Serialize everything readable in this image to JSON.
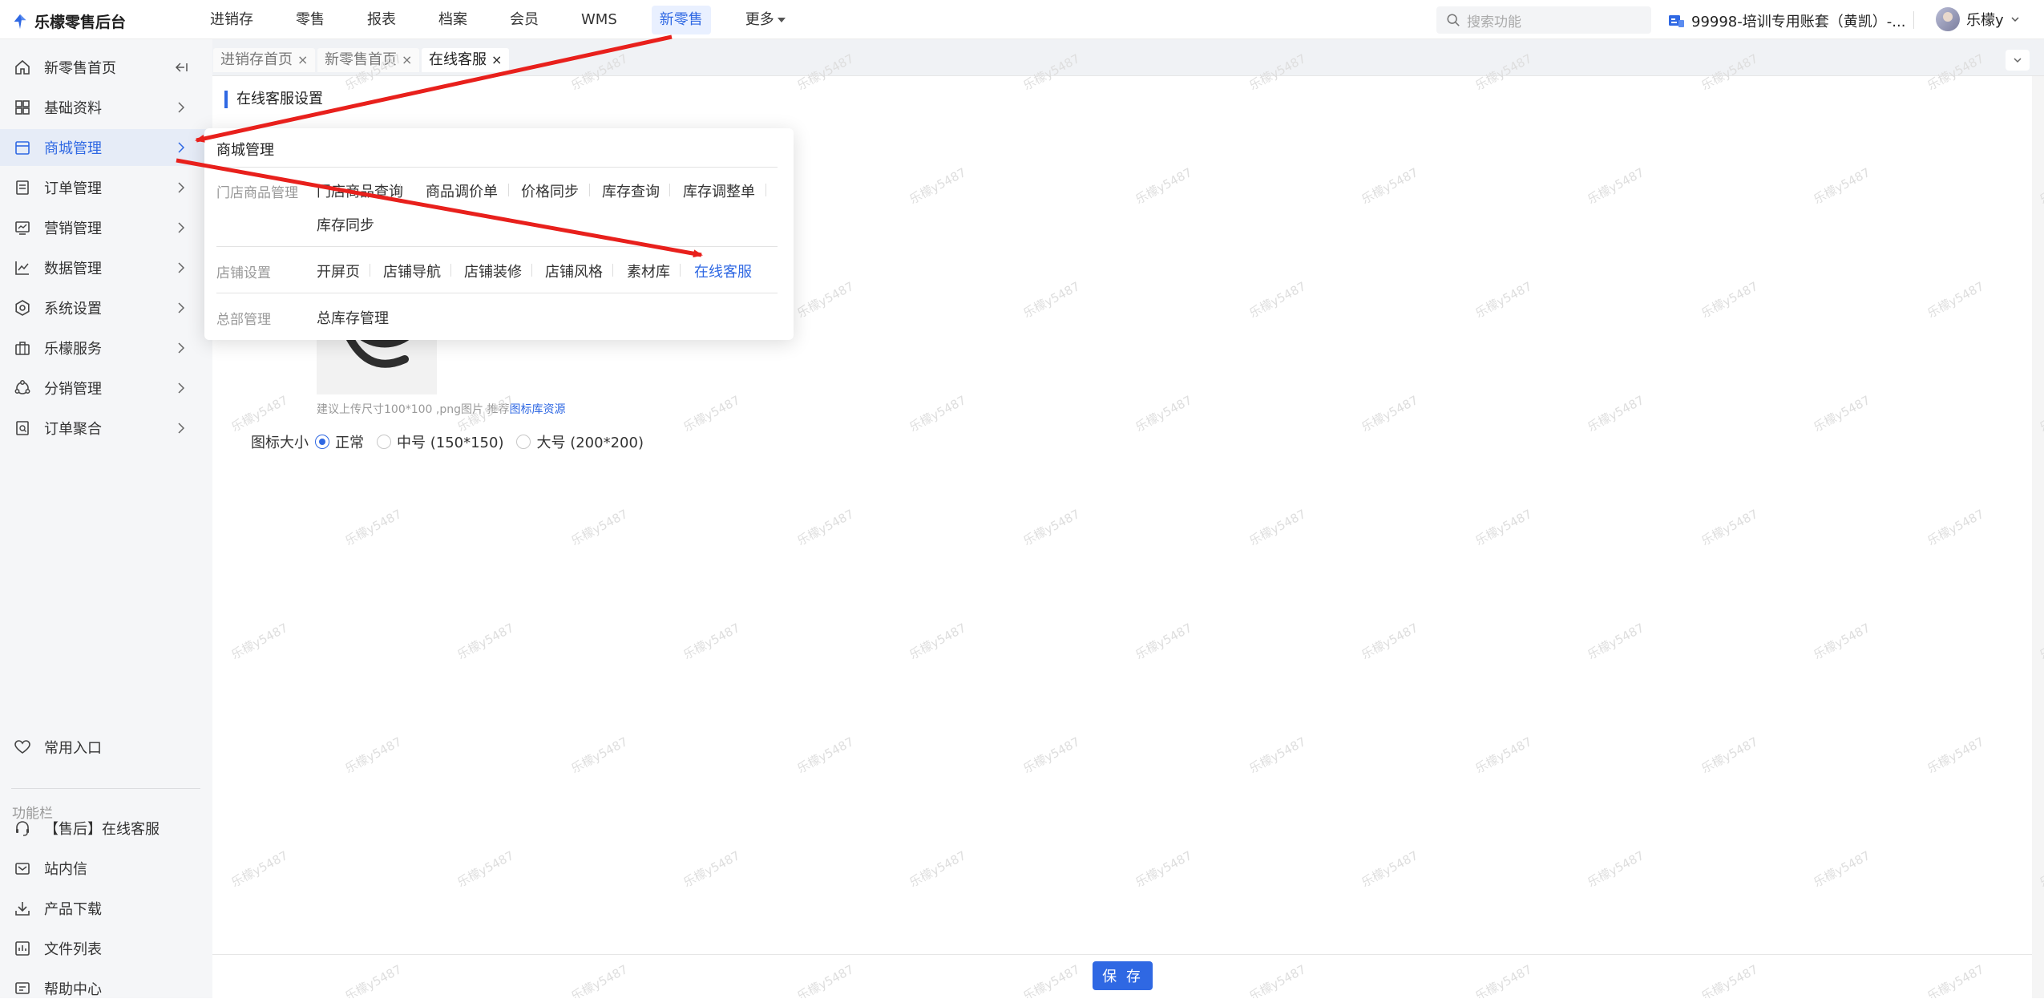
{
  "app": {
    "title": "乐檬零售后台"
  },
  "topnav": {
    "items": [
      "进销存",
      "零售",
      "报表",
      "档案",
      "会员",
      "WMS",
      "新零售",
      "更多"
    ],
    "active": "新零售"
  },
  "search": {
    "placeholder": "搜索功能"
  },
  "account": {
    "label": "99998-培训专用账套（黄凯）-..."
  },
  "user": {
    "name": "乐檬y"
  },
  "sidebar": {
    "items": [
      {
        "label": "新零售首页",
        "icon": "home-icon"
      },
      {
        "label": "基础资料",
        "icon": "grid-icon"
      },
      {
        "label": "商城管理",
        "icon": "store-icon"
      },
      {
        "label": "订单管理",
        "icon": "document-icon"
      },
      {
        "label": "营销管理",
        "icon": "monitor-icon"
      },
      {
        "label": "数据管理",
        "icon": "chart-icon"
      },
      {
        "label": "系统设置",
        "icon": "settings-icon"
      },
      {
        "label": "乐檬服务",
        "icon": "briefcase-icon"
      },
      {
        "label": "分销管理",
        "icon": "share-icon"
      },
      {
        "label": "订单聚合",
        "icon": "orders-icon"
      }
    ],
    "favorites": "常用入口",
    "section_label": "功能栏",
    "func_items": [
      {
        "label": "【售后】在线客服",
        "icon": "headset-icon"
      },
      {
        "label": "站内信",
        "icon": "mail-icon"
      },
      {
        "label": "产品下载",
        "icon": "download-icon"
      },
      {
        "label": "文件列表",
        "icon": "file-list-icon"
      },
      {
        "label": "帮助中心",
        "icon": "help-icon"
      }
    ]
  },
  "tabs": [
    {
      "label": "进销存首页",
      "close": "×"
    },
    {
      "label": "新零售首页",
      "close": "×"
    },
    {
      "label": "在线客服",
      "close": "×"
    }
  ],
  "main": {
    "section_title": "在线客服设置",
    "hint_text": "建议上传尺寸100*100 ,png图片 推荐",
    "hint_link": "图标库资源",
    "size_label": "图标大小",
    "size_options": [
      "正常",
      "中号 (150*150)",
      "大号 (200*200)"
    ],
    "size_selected": "正常",
    "save": "保 存"
  },
  "dropdown": {
    "title": "商城管理",
    "groups": [
      {
        "label": "门店商品管理",
        "links": [
          "门店商品查询",
          "商品调价单",
          "价格同步",
          "库存查询",
          "库存调整单",
          "库存同步"
        ]
      },
      {
        "label": "店铺设置",
        "links": [
          "开屏页",
          "店铺导航",
          "店铺装修",
          "店铺风格",
          "素材库",
          "在线客服"
        ]
      },
      {
        "label": "总部管理",
        "links": [
          "总库存管理"
        ]
      }
    ],
    "highlighted": "在线客服"
  },
  "watermark": "乐檬y5487",
  "colors": {
    "accent": "#2f68e3",
    "annotation": "#e8201c",
    "sidebar_bg": "#f5f6f8"
  }
}
